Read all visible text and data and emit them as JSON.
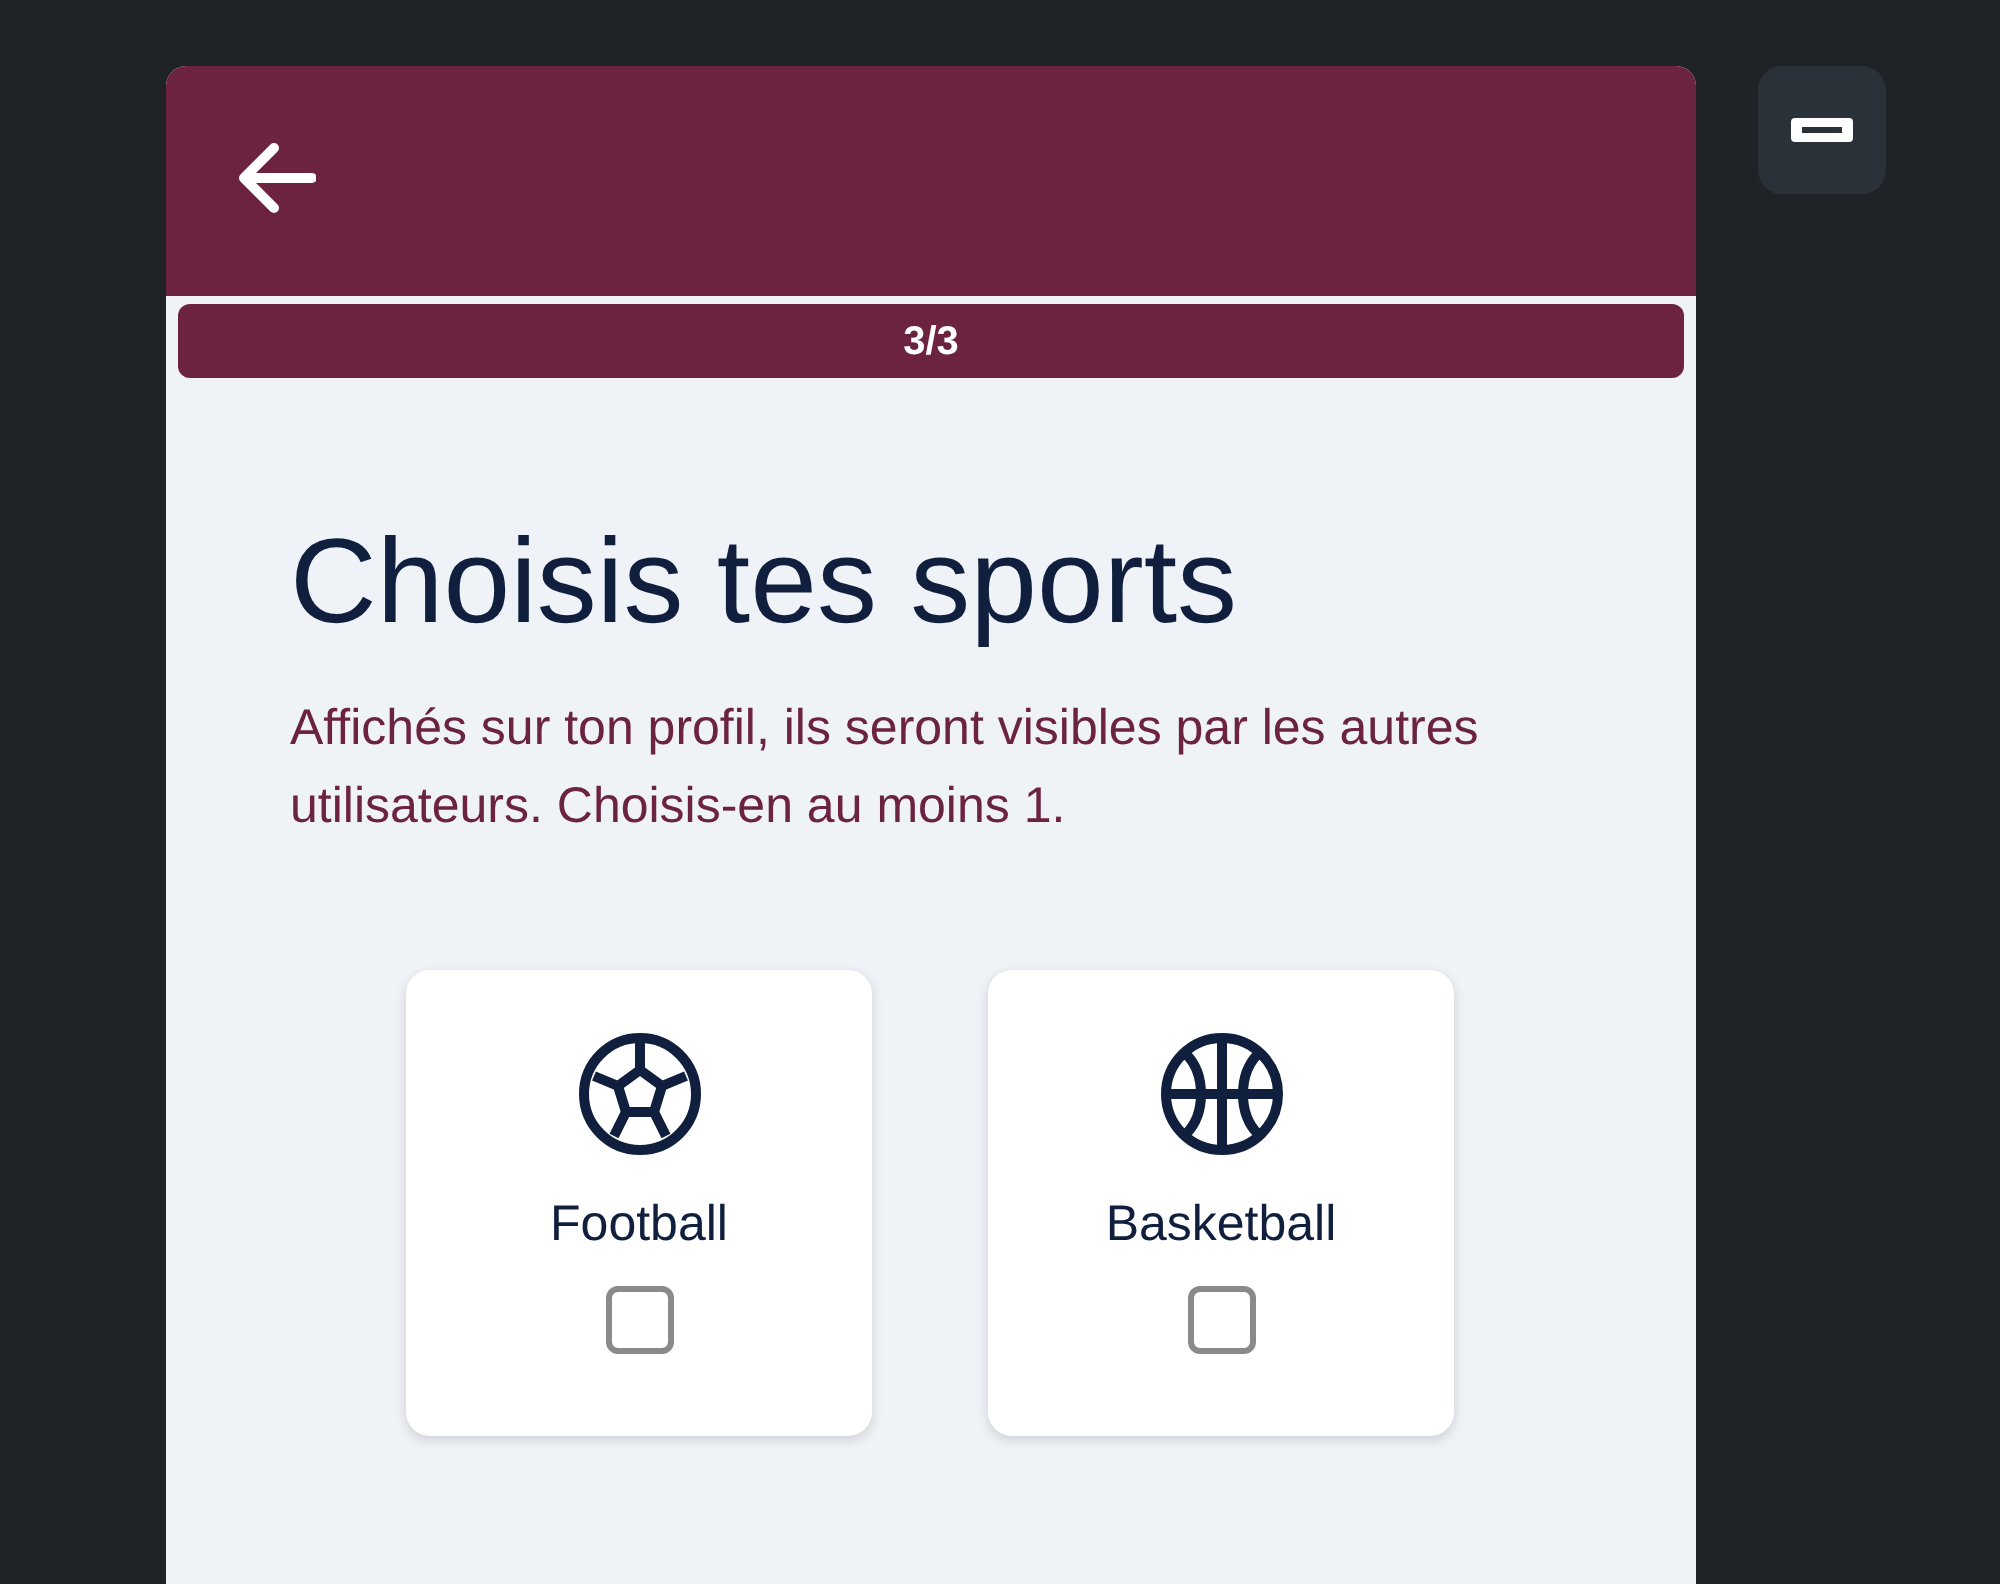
{
  "progress": {
    "label": "3/3",
    "level": 1
  },
  "title": "Choisis tes sports",
  "description": "Affichés sur ton profil, ils seront visibles par les autres utilisateurs. Choisis-en au moins 1.",
  "sports": [
    {
      "kind": "football",
      "label": "Football",
      "checked": false
    },
    {
      "kind": "basketball",
      "label": "Basketball",
      "checked": false
    }
  ]
}
